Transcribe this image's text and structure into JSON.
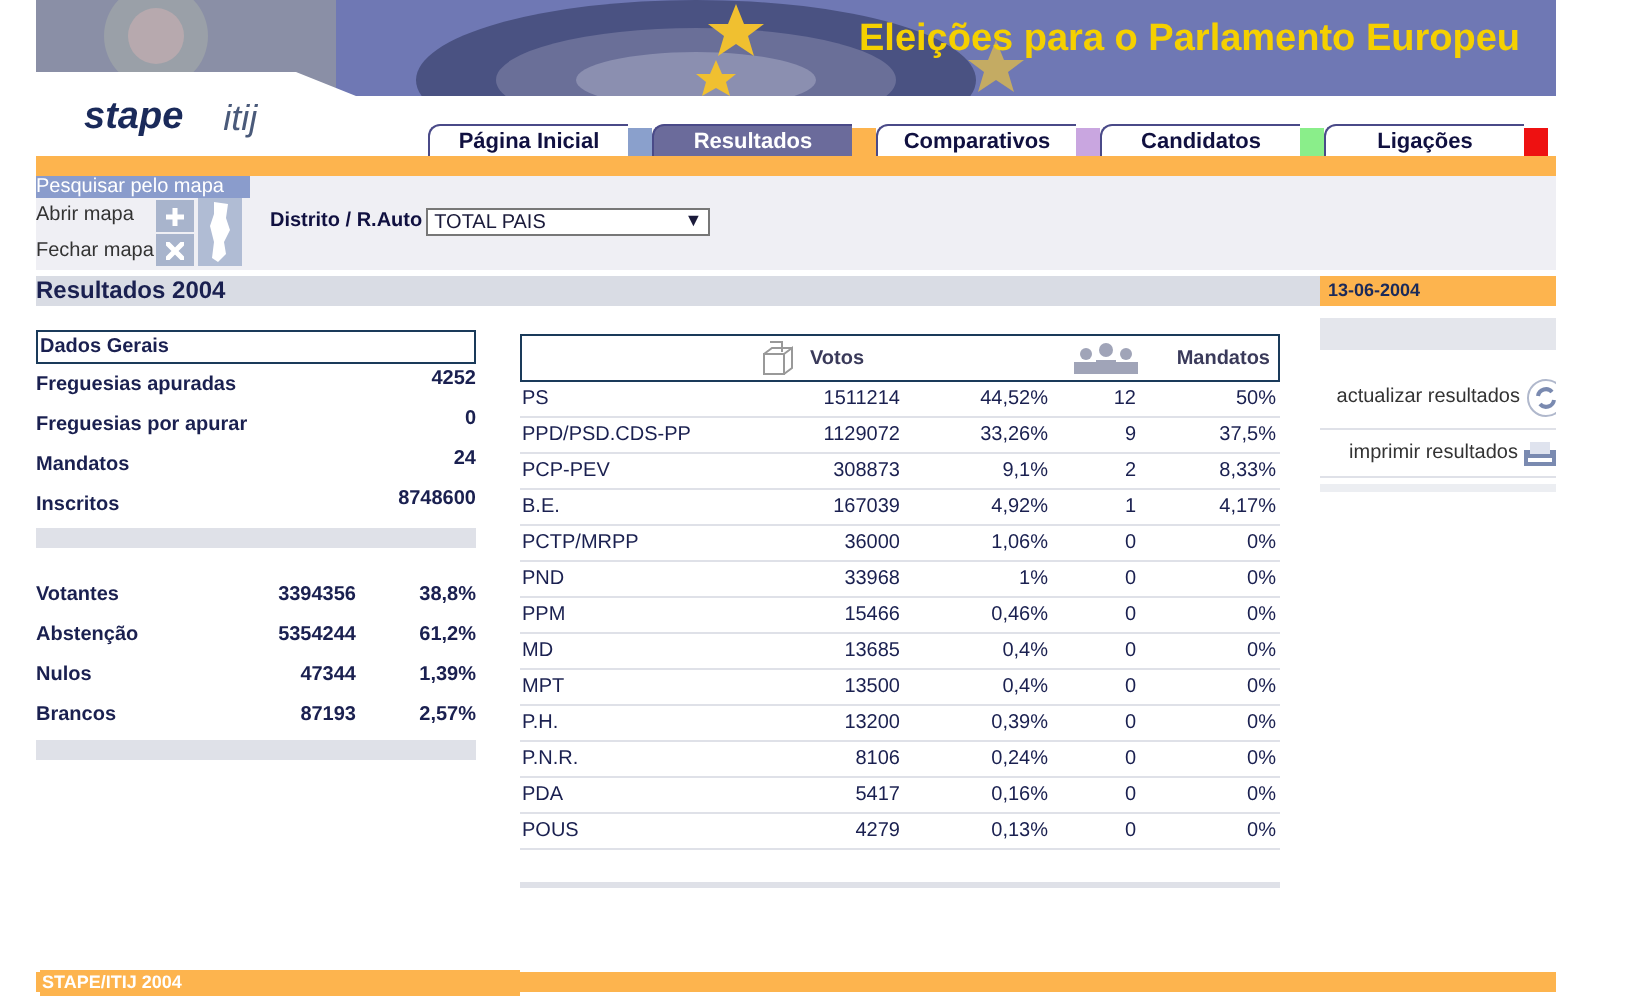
{
  "header": {
    "title": "Eleições para o Parlamento Europeu",
    "logos": [
      "stape",
      "itij"
    ]
  },
  "tabs": [
    {
      "label": "Página Inicial",
      "selected": false,
      "color": "#8aa0cc"
    },
    {
      "label": "Resultados",
      "selected": true,
      "color": "#fdb44e"
    },
    {
      "label": "Comparativos",
      "selected": false,
      "color": "#c9a6e0"
    },
    {
      "label": "Candidatos",
      "selected": false,
      "color": "#8aee8a"
    },
    {
      "label": "Ligações",
      "selected": false,
      "color": "#ee1111"
    }
  ],
  "map_search": {
    "title": "Pesquisar pelo mapa",
    "open_label": "Abrir mapa",
    "close_label": "Fechar mapa",
    "district_label": "Distrito / R.Auto",
    "district_value": "TOTAL PAIS",
    "dropdown_arrow": "▼"
  },
  "section_title": "Resultados 2004",
  "date": "13-06-2004",
  "general": {
    "title": "Dados Gerais",
    "rows": [
      {
        "label": "Freguesias apuradas",
        "value": "4252"
      },
      {
        "label": "Freguesias por apurar",
        "value": "0"
      },
      {
        "label": "Mandatos",
        "value": "24"
      },
      {
        "label": "Inscritos",
        "value": "8748600"
      }
    ]
  },
  "turnout": [
    {
      "label": "Votantes",
      "value": "3394356",
      "pct": "38,8%"
    },
    {
      "label": "Abstenção",
      "value": "5354244",
      "pct": "61,2%"
    },
    {
      "label": "Nulos",
      "value": "47344",
      "pct": "1,39%"
    },
    {
      "label": "Brancos",
      "value": "87193",
      "pct": "2,57%"
    }
  ],
  "table": {
    "columns": [
      "Votos",
      "Mandatos"
    ],
    "rows": [
      {
        "party": "PS",
        "votes": "1511214",
        "votes_pct": "44,52%",
        "seats": "12",
        "seats_pct": "50%"
      },
      {
        "party": "PPD/PSD.CDS-PP",
        "votes": "1129072",
        "votes_pct": "33,26%",
        "seats": "9",
        "seats_pct": "37,5%"
      },
      {
        "party": "PCP-PEV",
        "votes": "308873",
        "votes_pct": "9,1%",
        "seats": "2",
        "seats_pct": "8,33%"
      },
      {
        "party": "B.E.",
        "votes": "167039",
        "votes_pct": "4,92%",
        "seats": "1",
        "seats_pct": "4,17%"
      },
      {
        "party": "PCTP/MRPP",
        "votes": "36000",
        "votes_pct": "1,06%",
        "seats": "0",
        "seats_pct": "0%"
      },
      {
        "party": "PND",
        "votes": "33968",
        "votes_pct": "1%",
        "seats": "0",
        "seats_pct": "0%"
      },
      {
        "party": "PPM",
        "votes": "15466",
        "votes_pct": "0,46%",
        "seats": "0",
        "seats_pct": "0%"
      },
      {
        "party": "MD",
        "votes": "13685",
        "votes_pct": "0,4%",
        "seats": "0",
        "seats_pct": "0%"
      },
      {
        "party": "MPT",
        "votes": "13500",
        "votes_pct": "0,4%",
        "seats": "0",
        "seats_pct": "0%"
      },
      {
        "party": "P.H.",
        "votes": "13200",
        "votes_pct": "0,39%",
        "seats": "0",
        "seats_pct": "0%"
      },
      {
        "party": "P.N.R.",
        "votes": "8106",
        "votes_pct": "0,24%",
        "seats": "0",
        "seats_pct": "0%"
      },
      {
        "party": "PDA",
        "votes": "5417",
        "votes_pct": "0,16%",
        "seats": "0",
        "seats_pct": "0%"
      },
      {
        "party": "POUS",
        "votes": "4279",
        "votes_pct": "0,13%",
        "seats": "0",
        "seats_pct": "0%"
      }
    ]
  },
  "actions": [
    "actualizar resultados",
    "imprimir resultados"
  ],
  "footer": "STAPE/ITIJ 2004"
}
